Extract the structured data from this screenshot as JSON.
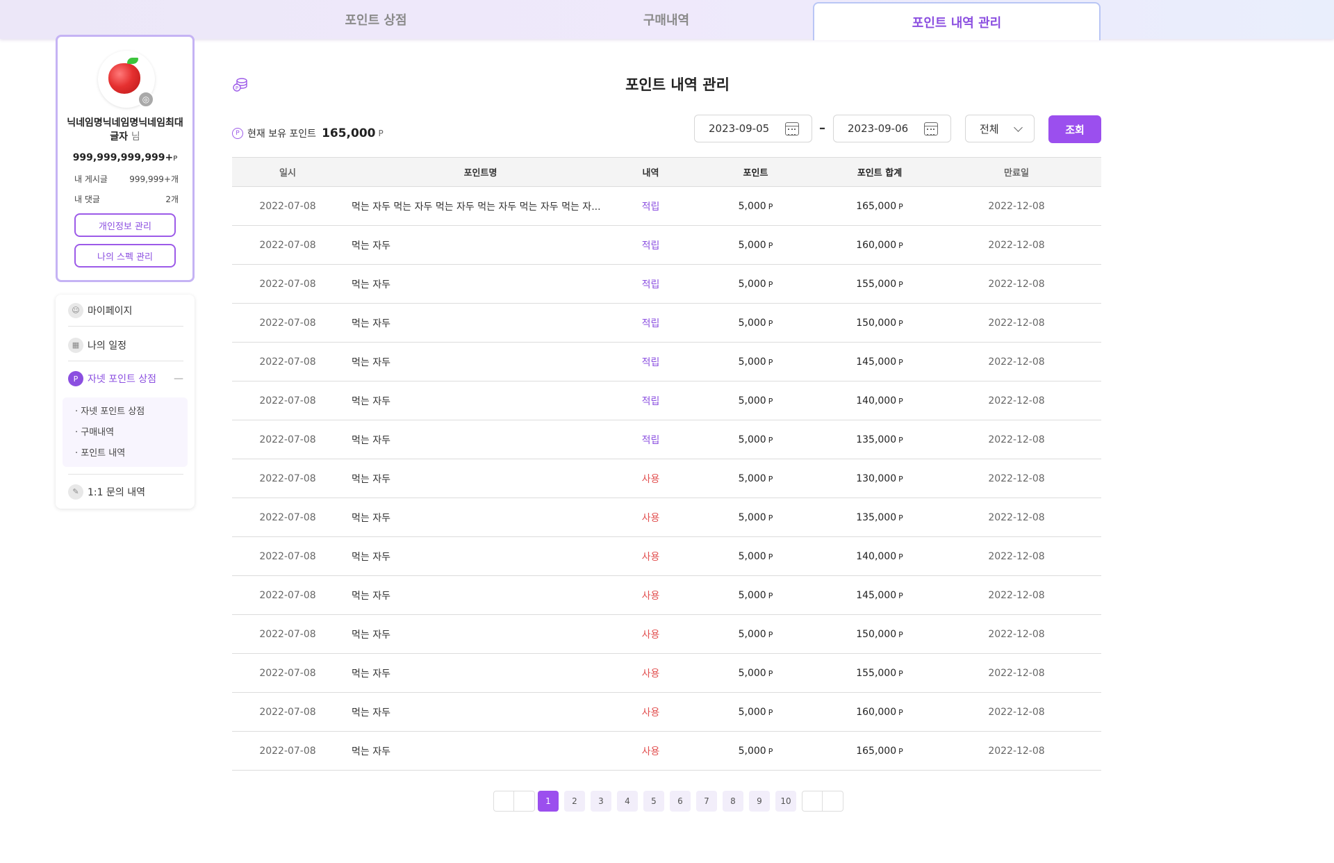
{
  "tabs": [
    "포인트 상점",
    "구매내역",
    "포인트 내역 관리"
  ],
  "profile": {
    "nickname": "닉네임명닉네임명닉네임최대글자",
    "honorific": "님",
    "points": "999,999,999,999+",
    "points_unit": "P",
    "posts_label": "내 게시글",
    "posts_value": "999,999+개",
    "comments_label": "내 댓글",
    "comments_value": "2개",
    "btn_profile": "개인정보 관리",
    "btn_spec": "나의 스펙 관리"
  },
  "menu": {
    "mypage": "마이페이지",
    "schedule": "나의 일정",
    "shop": "자넷 포인트 상점",
    "shop_collapse": "—",
    "sub": [
      "· 자넷 포인트 상점",
      "· 구매내역",
      "· 포인트 내역"
    ],
    "inquiry": "1:1 문의 내역"
  },
  "page": {
    "title": "포인트 내역 관리",
    "holding_label": "현재 보유 포인트",
    "holding_value": "165,000",
    "holding_unit": "P",
    "date_from": "2023-09-05",
    "date_sep": "–",
    "date_to": "2023-09-06",
    "filter": "전체",
    "search_btn": "조회"
  },
  "table": {
    "headers": [
      "일시",
      "포인트명",
      "내역",
      "포인트",
      "포인트 합계",
      "만료일"
    ],
    "unit": "P",
    "rows": [
      {
        "date": "2022-07-08",
        "name": "먹는 자두 먹는 자두 먹는 자두 먹는 자두 먹는 자두 먹는 자...",
        "type": "적립",
        "point": "5,000",
        "total": "165,000",
        "expire": "2022-12-08"
      },
      {
        "date": "2022-07-08",
        "name": "먹는 자두",
        "type": "적립",
        "point": "5,000",
        "total": "160,000",
        "expire": "2022-12-08"
      },
      {
        "date": "2022-07-08",
        "name": "먹는 자두",
        "type": "적립",
        "point": "5,000",
        "total": "155,000",
        "expire": "2022-12-08"
      },
      {
        "date": "2022-07-08",
        "name": "먹는 자두",
        "type": "적립",
        "point": "5,000",
        "total": "150,000",
        "expire": "2022-12-08"
      },
      {
        "date": "2022-07-08",
        "name": "먹는 자두",
        "type": "적립",
        "point": "5,000",
        "total": "145,000",
        "expire": "2022-12-08"
      },
      {
        "date": "2022-07-08",
        "name": "먹는 자두",
        "type": "적립",
        "point": "5,000",
        "total": "140,000",
        "expire": "2022-12-08"
      },
      {
        "date": "2022-07-08",
        "name": "먹는 자두",
        "type": "적립",
        "point": "5,000",
        "total": "135,000",
        "expire": "2022-12-08"
      },
      {
        "date": "2022-07-08",
        "name": "먹는 자두",
        "type": "사용",
        "point": "5,000",
        "total": "130,000",
        "expire": "2022-12-08"
      },
      {
        "date": "2022-07-08",
        "name": "먹는 자두",
        "type": "사용",
        "point": "5,000",
        "total": "135,000",
        "expire": "2022-12-08"
      },
      {
        "date": "2022-07-08",
        "name": "먹는 자두",
        "type": "사용",
        "point": "5,000",
        "total": "140,000",
        "expire": "2022-12-08"
      },
      {
        "date": "2022-07-08",
        "name": "먹는 자두",
        "type": "사용",
        "point": "5,000",
        "total": "145,000",
        "expire": "2022-12-08"
      },
      {
        "date": "2022-07-08",
        "name": "먹는 자두",
        "type": "사용",
        "point": "5,000",
        "total": "150,000",
        "expire": "2022-12-08"
      },
      {
        "date": "2022-07-08",
        "name": "먹는 자두",
        "type": "사용",
        "point": "5,000",
        "total": "155,000",
        "expire": "2022-12-08"
      },
      {
        "date": "2022-07-08",
        "name": "먹는 자두",
        "type": "사용",
        "point": "5,000",
        "total": "160,000",
        "expire": "2022-12-08"
      },
      {
        "date": "2022-07-08",
        "name": "먹는 자두",
        "type": "사용",
        "point": "5,000",
        "total": "165,000",
        "expire": "2022-12-08"
      }
    ]
  },
  "pagination": {
    "pages": [
      "1",
      "2",
      "3",
      "4",
      "5",
      "6",
      "7",
      "8",
      "9",
      "10"
    ],
    "current": "1"
  },
  "colors": {
    "accent": "#9b4fee",
    "earn": "#8b4fe0",
    "use": "#e25050"
  },
  "icons": [
    "coin-stack-icon",
    "camera-icon",
    "calendar-icon",
    "chevron-down-icon",
    "user-icon",
    "point-icon",
    "pencil-icon"
  ]
}
